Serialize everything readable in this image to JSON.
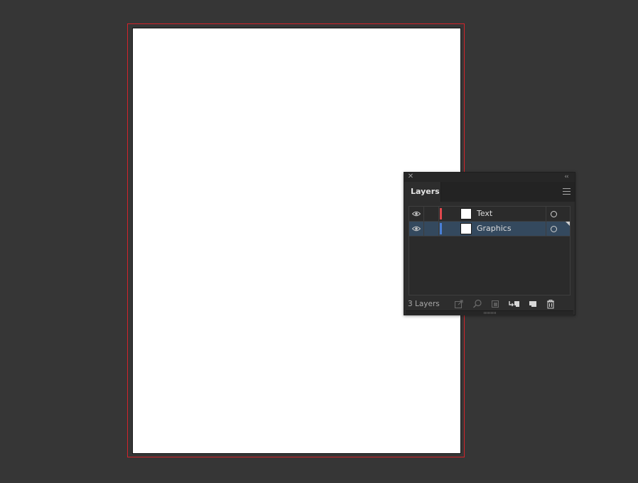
{
  "panel": {
    "close_symbol": "✕",
    "collapse_symbol": "‹‹",
    "tab_label": "Layers",
    "layers": [
      {
        "name": "Text",
        "color": "#e0484d",
        "visible": true,
        "selected": false
      },
      {
        "name": "Graphics",
        "color": "#4a7fd6",
        "visible": true,
        "selected": true
      }
    ],
    "footer": {
      "count_label": "3 Layers"
    }
  },
  "colors": {
    "bleed_guide": "#d2232a",
    "selection": "#34495e",
    "pasteboard": "#363636"
  }
}
